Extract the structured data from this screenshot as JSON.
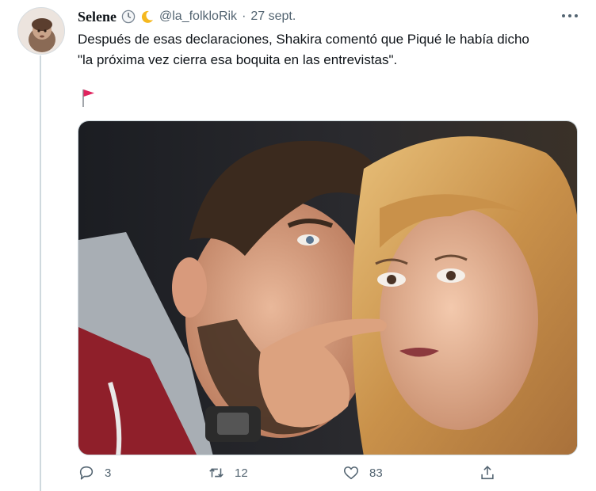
{
  "tweet": {
    "author_name": "Selene",
    "handle": "@la_folkloRik",
    "separator": "·",
    "date": "27 sept.",
    "text_line1": "Después de esas declaraciones, Shakira comentó que Piqué le había dicho",
    "text_line2": "\"la próxima vez cierra esa boquita en las entrevistas\".",
    "status_icons": [
      "clock-icon",
      "crescent-moon-icon"
    ],
    "flag_icon": "red-flag-icon"
  },
  "actions": {
    "reply_count": "3",
    "retweet_count": "12",
    "like_count": "83"
  },
  "colors": {
    "text": "#0f1419",
    "secondary": "#536471",
    "border": "#cfd9de",
    "flag": "#e0245e"
  }
}
